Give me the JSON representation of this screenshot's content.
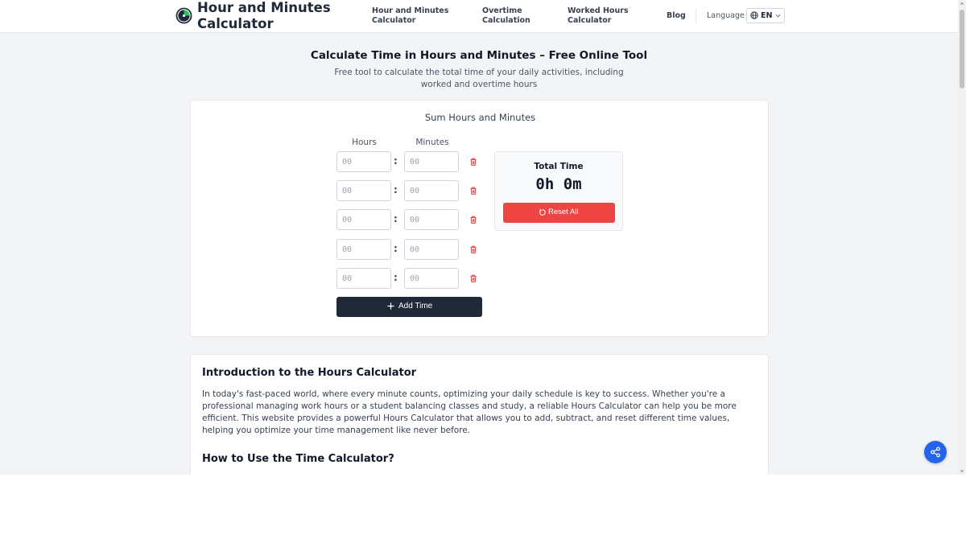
{
  "header": {
    "logo_text": "Hour and Minutes Calculator",
    "nav": [
      {
        "label": "Hour and Minutes Calculator"
      },
      {
        "label": "Overtime Calculation"
      },
      {
        "label": "Worked Hours Calculator"
      },
      {
        "label": "Blog"
      }
    ],
    "language_label": "Language",
    "language_code": "EN"
  },
  "hero": {
    "title": "Calculate Time in Hours and Minutes – Free Online Tool",
    "subtitle": "Free tool to calculate the total time of your daily activities, including worked and overtime hours"
  },
  "calculator": {
    "heading": "Sum Hours and Minutes",
    "hours_label": "Hours",
    "minutes_label": "Minutes",
    "rows": [
      {
        "hours_placeholder": "00",
        "minutes_placeholder": "00"
      },
      {
        "hours_placeholder": "00",
        "minutes_placeholder": "00"
      },
      {
        "hours_placeholder": "00",
        "minutes_placeholder": "00"
      },
      {
        "hours_placeholder": "00",
        "minutes_placeholder": "00"
      },
      {
        "hours_placeholder": "00",
        "minutes_placeholder": "00"
      }
    ],
    "colon": ":",
    "add_label": "Add Time",
    "total_label": "Total Time",
    "total_value": "0h 0m",
    "reset_label": "Reset All"
  },
  "article": {
    "heading": "Introduction to the Hours Calculator",
    "paragraph": "In today's fast-paced world, where every minute counts, optimizing your daily schedule is key to success. Whether you're a professional managing work hours or a student balancing classes and study, a reliable Hours Calculator can help you be more efficient. This website provides a powerful Hours Calculator that allows you to add, subtract, and reset different time values, helping you optimize your time management like never before.",
    "subheading": "How to Use the Time Calculator?"
  },
  "icons": {
    "logo": "clock-logo-icon",
    "globe": "globe-icon",
    "chevron": "chevron-down-icon",
    "trash": "trash-icon",
    "plus": "plus-icon",
    "reset": "reset-icon",
    "share": "share-icon"
  },
  "colors": {
    "accent_dark": "#1f2937",
    "reset_red": "#ef4444",
    "share_blue": "#2563eb",
    "trash_red": "#ef4444",
    "logo_green": "#22c55e"
  }
}
